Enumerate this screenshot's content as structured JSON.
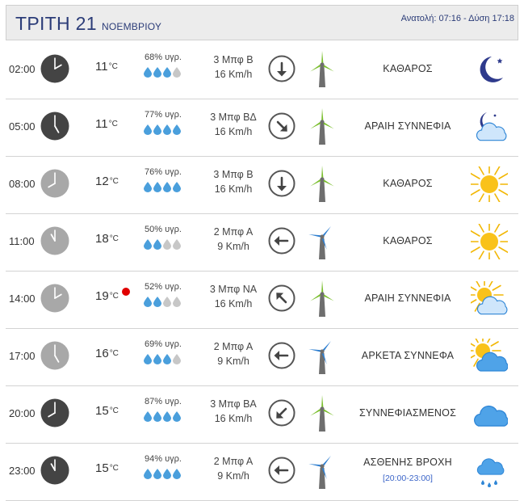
{
  "header": {
    "day": "ΤΡΙΤΗ 21",
    "month": "ΝΟΕΜΒΡΙΟΥ",
    "sun": "Ανατολή: 07:16  - Δύση 17:18"
  },
  "colors": {
    "header_text": "#2b3c78",
    "clock_night": "#444444",
    "clock_day": "#a8a8a8",
    "drop_full": "#4a9fdc",
    "drop_empty": "#c7c7c7",
    "turbine_green": "#7bbf2f",
    "turbine_blue": "#2f7fd0",
    "hot_dot": "#e00000"
  },
  "rows": [
    {
      "time": "02:00",
      "clock_hour": 2,
      "night": true,
      "temp": "11",
      "deg": "°C",
      "hot": false,
      "humidity": "68% υγρ.",
      "drops_filled": 3,
      "wind_force": "3 Μπφ Β",
      "wind_speed": "16 Km/h",
      "wind_arrow_deg": 180,
      "turbine": "green",
      "turbine_rotation": 0,
      "condition": "ΚΑΘΑΡΟΣ",
      "condition_sub": "",
      "icon": "moon-icon"
    },
    {
      "time": "05:00",
      "clock_hour": 5,
      "night": true,
      "temp": "11",
      "deg": "°C",
      "hot": false,
      "humidity": "77% υγρ.",
      "drops_filled": 4,
      "wind_force": "3 Μπφ ΒΔ",
      "wind_speed": "16 Km/h",
      "wind_arrow_deg": 135,
      "turbine": "green",
      "turbine_rotation": 0,
      "condition": "ΑΡΑΙΗ ΣΥΝΝΕΦΙΑ",
      "condition_sub": "",
      "icon": "moon-cloud-icon"
    },
    {
      "time": "08:00",
      "clock_hour": 8,
      "night": false,
      "temp": "12",
      "deg": "°C",
      "hot": false,
      "humidity": "76% υγρ.",
      "drops_filled": 4,
      "wind_force": "3 Μπφ Β",
      "wind_speed": "16 Km/h",
      "wind_arrow_deg": 180,
      "turbine": "green",
      "turbine_rotation": 0,
      "condition": "ΚΑΘΑΡΟΣ",
      "condition_sub": "",
      "icon": "sun-icon"
    },
    {
      "time": "11:00",
      "clock_hour": 11,
      "night": false,
      "temp": "18",
      "deg": "°C",
      "hot": false,
      "humidity": "50% υγρ.",
      "drops_filled": 2,
      "wind_force": "2 Μπφ Α",
      "wind_speed": "9 Km/h",
      "wind_arrow_deg": 270,
      "turbine": "blue",
      "turbine_rotation": 40,
      "condition": "ΚΑΘΑΡΟΣ",
      "condition_sub": "",
      "icon": "sun-icon"
    },
    {
      "time": "14:00",
      "clock_hour": 2,
      "night": false,
      "temp": "19",
      "deg": "°C",
      "hot": true,
      "humidity": "52% υγρ.",
      "drops_filled": 2,
      "wind_force": "3 Μπφ ΝΑ",
      "wind_speed": "16 Km/h",
      "wind_arrow_deg": 315,
      "turbine": "green",
      "turbine_rotation": 0,
      "condition": "ΑΡΑΙΗ ΣΥΝΝΕΦΙΑ",
      "condition_sub": "",
      "icon": "sun-light-cloud-icon"
    },
    {
      "time": "17:00",
      "clock_hour": 5,
      "night": false,
      "temp": "16",
      "deg": "°C",
      "hot": false,
      "humidity": "69% υγρ.",
      "drops_filled": 3,
      "wind_force": "2 Μπφ Α",
      "wind_speed": "9 Km/h",
      "wind_arrow_deg": 270,
      "turbine": "blue",
      "turbine_rotation": 40,
      "condition": "ΑΡΚΕΤΑ ΣΥΝΝΕΦΑ",
      "condition_sub": "",
      "icon": "sun-cloud-icon"
    },
    {
      "time": "20:00",
      "clock_hour": 8,
      "night": true,
      "temp": "15",
      "deg": "°C",
      "hot": false,
      "humidity": "87% υγρ.",
      "drops_filled": 4,
      "wind_force": "3 Μπφ ΒΑ",
      "wind_speed": "16 Km/h",
      "wind_arrow_deg": 225,
      "turbine": "green",
      "turbine_rotation": 0,
      "condition": "ΣΥΝΝΕΦΙΑΣΜΕΝΟΣ",
      "condition_sub": "",
      "icon": "cloud-icon"
    },
    {
      "time": "23:00",
      "clock_hour": 11,
      "night": true,
      "temp": "15",
      "deg": "°C",
      "hot": false,
      "humidity": "94% υγρ.",
      "drops_filled": 4,
      "wind_force": "2 Μπφ Α",
      "wind_speed": "9 Km/h",
      "wind_arrow_deg": 270,
      "turbine": "blue",
      "turbine_rotation": 40,
      "condition": "ΑΣΘΕΝΗΣ ΒΡΟΧΗ",
      "condition_sub": "[20:00-23:00]",
      "icon": "rain-cloud-icon"
    }
  ]
}
